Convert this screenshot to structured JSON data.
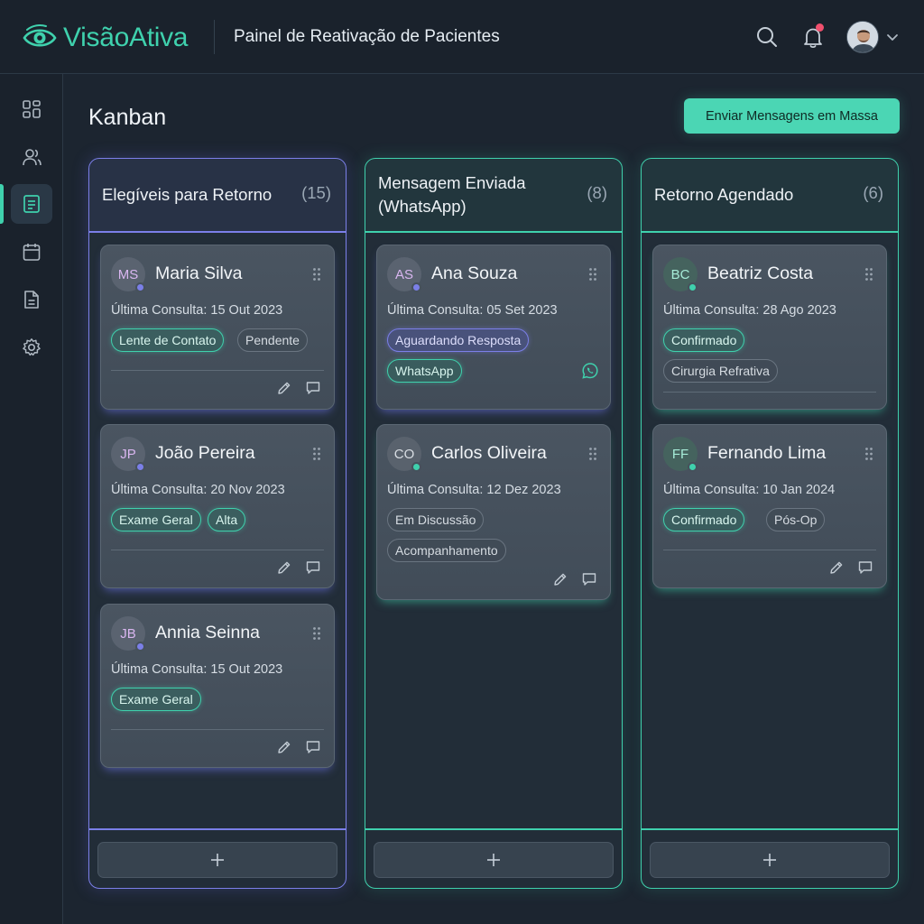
{
  "app": {
    "brand": "VisãoAtiva",
    "title": "Painel de Reativação de Pacientes"
  },
  "page": {
    "title": "Kanban",
    "bulk_button": "Enviar Mensagens em Massa"
  },
  "colors": {
    "accent_green": "#3fd1ad",
    "accent_purple": "#7b7fe8",
    "notification": "#f0506e"
  },
  "columns": [
    {
      "title": "Elegíveis para Retorno",
      "count": "(15)",
      "cards": [
        {
          "initials": "MS",
          "name": "Maria Silva",
          "meta": "Última Consulta: 15 Out 2023",
          "tags": [
            "Lente de Contato",
            "Pendente"
          ]
        },
        {
          "initials": "JP",
          "name": "João Pereira",
          "meta": "Última Consulta: 20 Nov 2023",
          "tags": [
            "Exame Geral",
            "Alta"
          ]
        },
        {
          "initials": "JB",
          "name": "Annia Seinna",
          "meta": "Última Consulta: 15 Out 2023",
          "tags": [
            "Exame Geral"
          ]
        }
      ]
    },
    {
      "title_line1": "Mensagem Enviada",
      "title_line2": "(WhatsApp)",
      "count": "(8)",
      "cards": [
        {
          "initials": "AS",
          "name": "Ana Souza",
          "meta": "Última Consulta: 05 Set 2023",
          "tags": [
            "Aguardando Resposta",
            "WhatsApp"
          ]
        },
        {
          "initials": "CO",
          "name": "Carlos Oliveira",
          "meta": "Última Consulta: 12 Dez 2023",
          "tags": [
            "Em Discussão",
            "Acompanhamento"
          ]
        }
      ]
    },
    {
      "title": "Retorno Agendado",
      "count": "(6)",
      "cards": [
        {
          "initials": "BC",
          "name": "Beatriz Costa",
          "meta": "Última Consulta: 28 Ago 2023",
          "tags": [
            "Confirmado",
            "Cirurgia Refrativa"
          ]
        },
        {
          "initials": "FF",
          "name": "Fernando Lima",
          "meta": "Última Consulta: 10 Jan 2024",
          "tags": [
            "Confirmado",
            "Pós-Op"
          ]
        }
      ]
    }
  ]
}
